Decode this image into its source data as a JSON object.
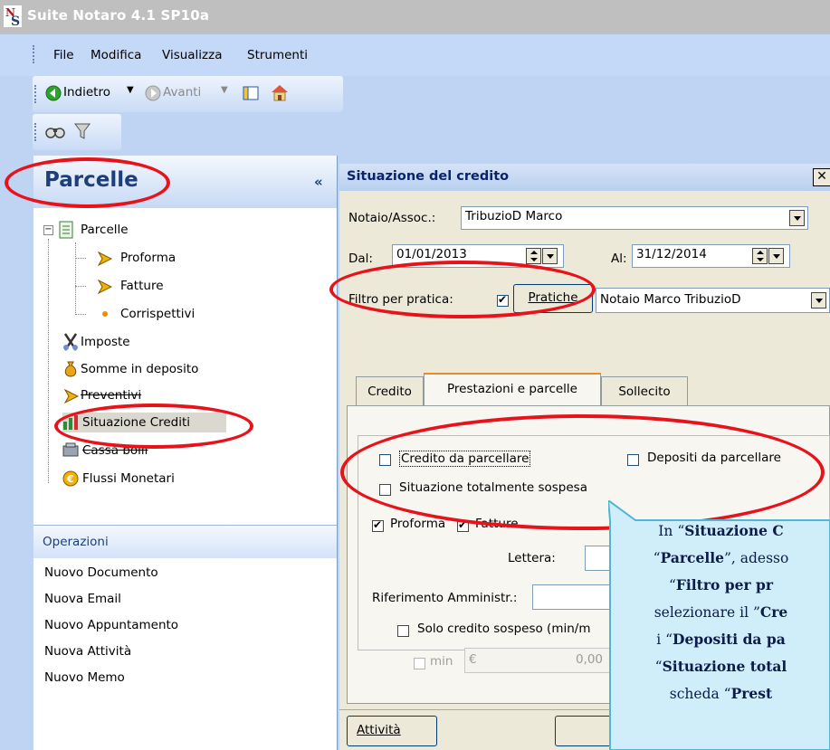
{
  "window": {
    "title": "Suite Notaro 4.1 SP10a"
  },
  "menu": [
    "File",
    "Modifica",
    "Visualizza",
    "Strumenti"
  ],
  "toolbar": {
    "back_label": "Indietro",
    "forward_label": "Avanti"
  },
  "left_pane": {
    "title": "Parcelle",
    "collapse": "«",
    "tree": [
      "Parcelle",
      "Proforma",
      "Fatture",
      "Corrispettivi",
      "Imposte",
      "Somme in deposito",
      "Preventivi",
      "Situazione Crediti",
      "Cassa bolli",
      "Flussi Monetari"
    ],
    "operations_title": "Operazioni",
    "operations": [
      "Nuovo Documento",
      "Nuova Email",
      "Nuovo Appuntamento",
      "Nuova Attività",
      "Nuovo Memo"
    ]
  },
  "dialog": {
    "title": "Situazione del credito",
    "close": "✕",
    "notaio_label": "Notaio/Assoc.:",
    "notaio_value": "TribuzioD Marco",
    "dal_label": "Dal:",
    "dal_value": "01/01/2013",
    "al_label": "Al:",
    "al_value": "31/12/2014",
    "filtro_label": "Filtro per pratica:",
    "pratiche_button": "Pratiche",
    "pratica_value": "Notaio Marco TribuzioD",
    "tabs": [
      "Credito",
      "Prestazioni e parcelle",
      "Sollecito"
    ],
    "chk_credito_parcellare": "Credito da parcellare",
    "chk_depositi_parcellare": "Depositi da parcellare",
    "chk_sospesa": "Situazione totalmente sospesa",
    "chk_proforma": "Proforma",
    "chk_fatture": "Fatture",
    "lettera_label": "Lettera:",
    "riferimento_label": "Riferimento Amministr.:",
    "solo_credito": "Solo credito sospeso (min/m",
    "min_label": "min",
    "euro": "€",
    "min_value": "0,00",
    "attivita_button": "Attività"
  },
  "callout": {
    "lines": [
      [
        "In “",
        "Situazione C",
        ""
      ],
      [
        "“",
        "Parcelle",
        "”, adesso"
      ],
      [
        "“",
        "Filtro per pr",
        ""
      ],
      [
        "selezionare il ”",
        "Cre",
        ""
      ],
      [
        "i “",
        "Depositi da pa",
        ""
      ],
      [
        "“",
        "Situazione total",
        ""
      ],
      [
        "scheda “",
        "Prest",
        ""
      ]
    ]
  },
  "colors": {
    "highlight": "#e8121b",
    "callout_fill": "#cfeefa",
    "callout_border": "#4fb6d6"
  }
}
